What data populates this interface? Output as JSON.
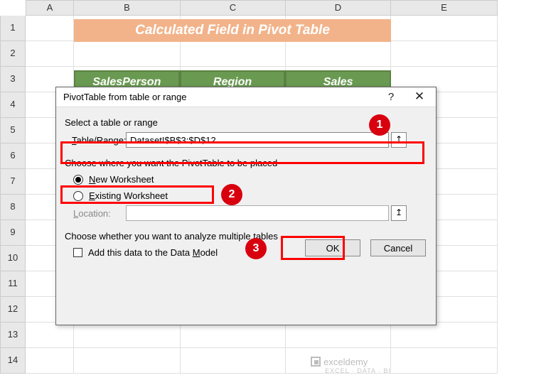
{
  "columns": [
    "A",
    "B",
    "C",
    "D",
    "E"
  ],
  "rows": [
    "1",
    "2",
    "3",
    "4",
    "5",
    "6",
    "7",
    "8",
    "9",
    "10",
    "11",
    "12",
    "13",
    "14"
  ],
  "banner": {
    "title": "Calculated Field in Pivot Table"
  },
  "table": {
    "headers": [
      "SalesPerson",
      "Region",
      "Sales"
    ]
  },
  "dialog": {
    "title": "PivotTable from table or range",
    "select_label": "Select a table or range",
    "table_range_label": "Table/Range:",
    "table_range_value": "Dataset!$B$3:$D$12",
    "placement_label": "Choose where you want the PivotTable to be placed",
    "new_ws": "New Worksheet",
    "existing_ws": "Existing Worksheet",
    "location_label": "Location:",
    "analyze_label": "Choose whether you want to analyze multiple tables",
    "add_data_model": "Add this data to the Data Model",
    "ok": "OK",
    "cancel": "Cancel",
    "help": "?",
    "close": "✕",
    "collapse": "↥"
  },
  "badges": {
    "b1": "1",
    "b2": "2",
    "b3": "3"
  },
  "watermark": {
    "name": "exceldemy",
    "sub": "EXCEL · DATA · BI"
  }
}
